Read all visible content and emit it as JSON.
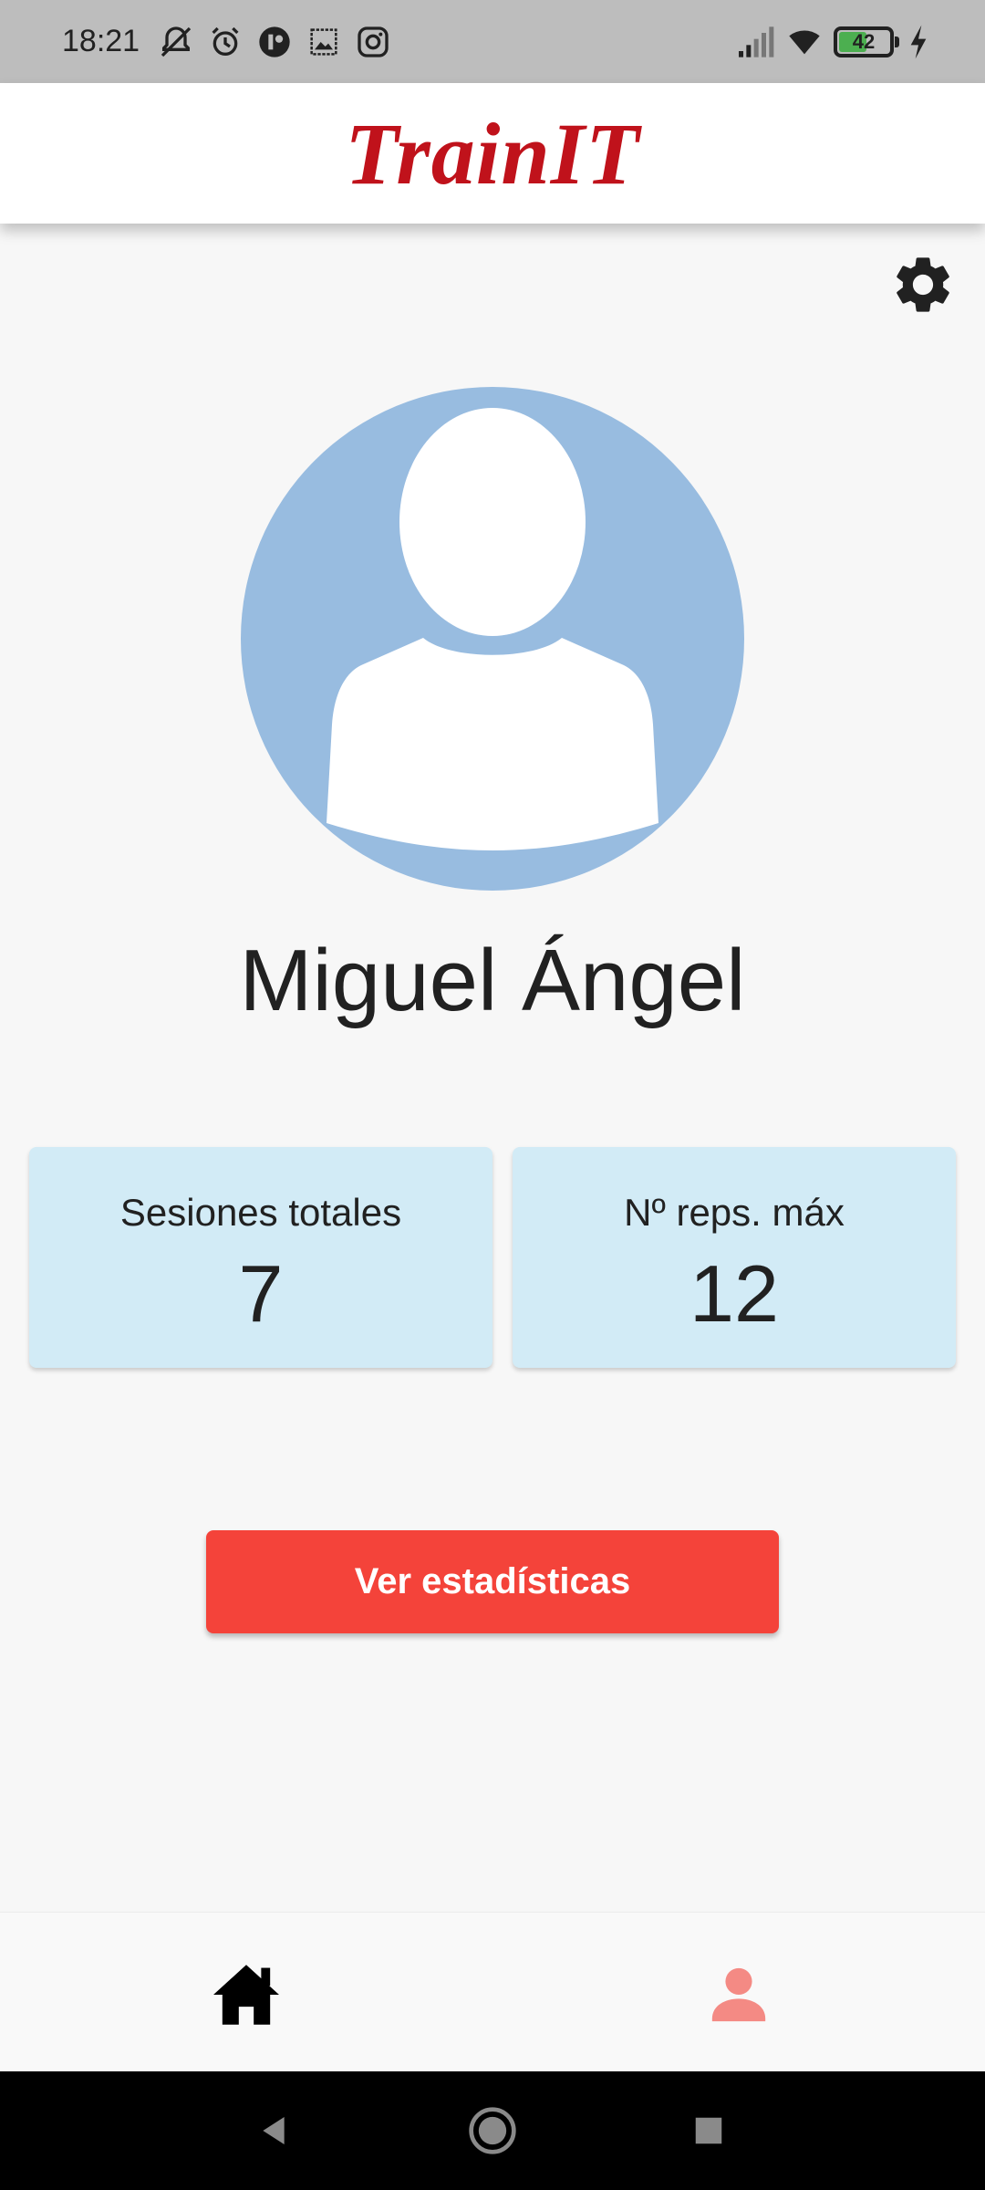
{
  "status_bar": {
    "time": "18:21",
    "battery_level": "42",
    "icons": [
      "muted-alarm-icon",
      "alarm-icon",
      "app-notification-icon",
      "image-icon",
      "instagram-icon",
      "signal-icon",
      "wifi-icon",
      "battery-icon",
      "charging-icon"
    ]
  },
  "app_bar": {
    "title": "TrainIT",
    "title_color": "#c0121b"
  },
  "profile": {
    "name": "Miguel Ángel",
    "avatar_color": "#98bce0"
  },
  "stats": [
    {
      "label": "Sesiones totales",
      "value": "7"
    },
    {
      "label": "Nº reps. máx",
      "value": "12"
    }
  ],
  "actions": {
    "stats_button_label": "Ver estadísticas",
    "button_color": "#f4433a"
  },
  "bottom_nav": {
    "items": [
      {
        "icon": "home-icon",
        "active": false
      },
      {
        "icon": "profile-icon",
        "active": true,
        "color": "#f48a84"
      }
    ]
  }
}
